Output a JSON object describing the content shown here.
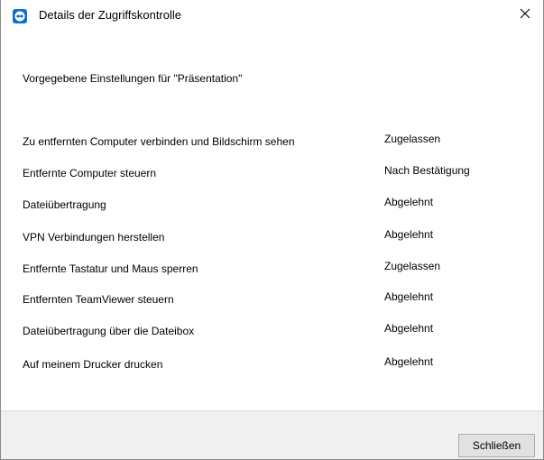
{
  "window": {
    "title": "Details der Zugriffskontrolle",
    "subtitle": "Vorgegebene Einstellungen für \"Präsentation\""
  },
  "settings": [
    {
      "label": "Zu entfernten Computer verbinden und Bildschirm sehen",
      "value": "Zugelassen"
    },
    {
      "label": "Entfernte Computer steuern",
      "value": "Nach Bestätigung"
    },
    {
      "label": "Dateiübertragung",
      "value": "Abgelehnt"
    },
    {
      "label": "VPN Verbindungen herstellen",
      "value": "Abgelehnt"
    },
    {
      "label": "Entfernte Tastatur und Maus sperren",
      "value": "Zugelassen"
    },
    {
      "label": "Entfernten TeamViewer steuern",
      "value": "Abgelehnt"
    },
    {
      "label": "Dateiübertragung über die Dateibox",
      "value": "Abgelehnt"
    },
    {
      "label": "Auf meinem Drucker drucken",
      "value": "Abgelehnt"
    }
  ],
  "footer": {
    "close_label": "Schließen"
  },
  "icons": {
    "app": "teamviewer-icon",
    "close": "close-icon"
  },
  "colors": {
    "accent": "#0e71c8",
    "footer_bg": "#f0f0f0"
  }
}
